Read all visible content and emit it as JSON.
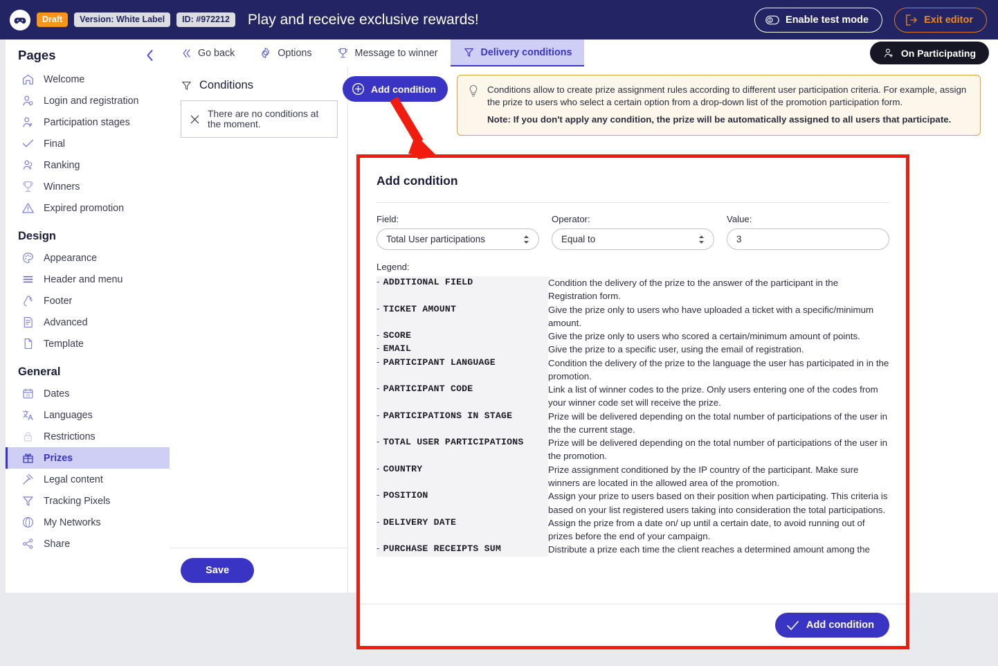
{
  "topbar": {
    "logo_icon": "gamepad-icon",
    "draft_badge": "Draft",
    "version_badge": "Version: White Label",
    "id_badge": "ID: #972212",
    "promo_title": "Play and receive exclusive rewards!",
    "test_mode_label": "Enable test mode",
    "test_mode_icon": "toggle-icon",
    "exit_label": "Exit editor",
    "exit_icon": "exit-icon"
  },
  "sidebar": {
    "title": "Pages",
    "collapse_icon": "chevron-left-icon",
    "pages": [
      {
        "label": "Welcome",
        "icon": "home-icon"
      },
      {
        "label": "Login and registration",
        "icon": "user-login-icon"
      },
      {
        "label": "Participation stages",
        "icon": "user-stages-icon"
      },
      {
        "label": "Final",
        "icon": "check-icon"
      },
      {
        "label": "Ranking",
        "icon": "ranking-icon"
      },
      {
        "label": "Winners",
        "icon": "trophy-icon"
      },
      {
        "label": "Expired promotion",
        "icon": "warning-icon"
      }
    ],
    "design_title": "Design",
    "design": [
      {
        "label": "Appearance",
        "icon": "palette-icon"
      },
      {
        "label": "Header and menu",
        "icon": "menu-lines-icon"
      },
      {
        "label": "Footer",
        "icon": "footer-icon"
      },
      {
        "label": "Advanced",
        "icon": "document-code-icon"
      },
      {
        "label": "Template",
        "icon": "page-icon"
      }
    ],
    "general_title": "General",
    "general": [
      {
        "label": "Dates",
        "icon": "calendar-icon",
        "active": false
      },
      {
        "label": "Languages",
        "icon": "translate-icon",
        "active": false
      },
      {
        "label": "Restrictions",
        "icon": "lock-icon",
        "active": false
      },
      {
        "label": "Prizes",
        "icon": "gift-icon",
        "active": true
      },
      {
        "label": "Legal content",
        "icon": "gavel-icon",
        "active": false
      },
      {
        "label": "Tracking Pixels",
        "icon": "funnel-icon",
        "active": false
      },
      {
        "label": "My Networks",
        "icon": "network-icon",
        "active": false
      },
      {
        "label": "Share",
        "icon": "share-icon",
        "active": false
      }
    ]
  },
  "tabs": [
    {
      "label": "Go back",
      "icon": "double-chevron-left-icon",
      "active": false
    },
    {
      "label": "Options",
      "icon": "gear-icon",
      "active": false
    },
    {
      "label": "Message to winner",
      "icon": "trophy-icon",
      "active": false
    },
    {
      "label": "Delivery conditions",
      "icon": "funnel-icon",
      "active": true
    }
  ],
  "participating_pill": {
    "label": "On Participating",
    "icon": "user-add-icon"
  },
  "conditions_panel": {
    "title": "Conditions",
    "title_icon": "funnel-icon",
    "add_button": "Add condition",
    "add_button_icon": "plus-circle-icon",
    "empty_icon": "x-icon",
    "empty_text": "There are no conditions at the moment.",
    "save_label": "Save"
  },
  "info_box": {
    "icon": "lightbulb-icon",
    "paragraph": "Conditions allow to create prize assignment rules according to different user participation criteria. For example, assign the prize to users who select a certain option from a drop-down list of the promotion participation form.",
    "note": "Note: If you don't apply any condition, the prize will be automatically assigned to all users that participate."
  },
  "modal": {
    "title": "Add condition",
    "accent_color": "#3a34c4",
    "highlight_color": "#f01d0e",
    "fields": {
      "field_label": "Field:",
      "field_value": "Total User participations",
      "operator_label": "Operator:",
      "operator_value": "Equal to",
      "value_label": "Value:",
      "value_value": "3"
    },
    "legend_label": "Legend:",
    "legend": [
      {
        "key": "ADDITIONAL FIELD",
        "desc": "Condition the delivery of the prize to the answer of the participant in the Registration form."
      },
      {
        "key": "TICKET AMOUNT",
        "desc": "Give the prize only to users who have uploaded a ticket with a specific/minimum amount."
      },
      {
        "key": "SCORE",
        "desc": "Give the prize only to users who scored a certain/minimum amount of points."
      },
      {
        "key": "EMAIL",
        "desc": "Give the prize to a specific user, using the email of registration."
      },
      {
        "key": "PARTICIPANT LANGUAGE",
        "desc": "Condition the delivery of the prize to the language the user has participated in in the promotion."
      },
      {
        "key": "PARTICIPANT CODE",
        "desc": "Link a list of winner codes to the prize. Only users entering one of the codes from your winner code set will receive the prize."
      },
      {
        "key": "PARTICIPATIONS IN STAGE",
        "desc": "Prize will be delivered depending on the total number of participations of the user in the the current stage."
      },
      {
        "key": "TOTAL USER PARTICIPATIONS",
        "desc": "Prize will be delivered depending on the total number of participations of the user in the promotion."
      },
      {
        "key": "COUNTRY",
        "desc": "Prize assignment conditioned by the IP country of the participant. Make sure winners are located in the allowed area of the promotion."
      },
      {
        "key": "POSITION",
        "desc": "Assign your prize to users based on their position when participating. This criteria is based on your list registered users taking into consideration the total participations."
      },
      {
        "key": "DELIVERY DATE",
        "desc": "Assign the prize from a date on/ up until a certain date, to avoid running out of prizes before the end of your campaign."
      },
      {
        "key": "PURCHASE RECEIPTS SUM",
        "desc": "Distribute a prize each time the client reaches a determined amount among the"
      }
    ],
    "submit_label": "Add condition",
    "submit_icon": "check-icon"
  }
}
